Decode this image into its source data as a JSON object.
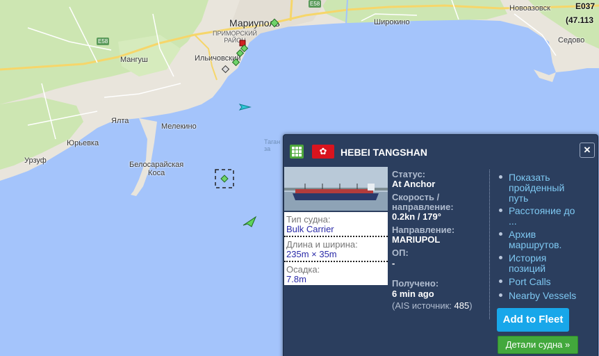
{
  "map": {
    "colors": {
      "sea": "#a4c4fb",
      "land": "#e9e5dc",
      "green": "#cde6b2",
      "highway": "#f6d66a",
      "road": "#ffffff"
    },
    "places": {
      "mariupol": "Мариуполь",
      "primorsky": "ПРИМОРСКИЙ\nРАЙОН",
      "ilyichevsky": "Ильичовский",
      "mangush": "Мангуш",
      "shirokino": "Широкино",
      "novoazovsk": "Новоазовск",
      "sedovo": "Седово",
      "yalta": "Ялта",
      "melekino": "Мелекино",
      "yurievka": "Юрьевка",
      "urzuf": "Урзуф",
      "belosaraiskaya": "Белосарайская\nКоса",
      "taganrog_bay_fragment": "Таган\nза"
    },
    "roads": {
      "e58_left": "E58",
      "e58_top": "E58"
    },
    "corner_coords": {
      "line1": "E037",
      "line2": "(47.113"
    },
    "icons": [
      "vessel-green-diamond-icon",
      "vessel-cyan-arrow-icon",
      "vessel-green-arrow-icon",
      "selection-box-icon"
    ]
  },
  "popup": {
    "vessel_name": "HEBEI TANGSHAN",
    "flag": "hong-kong-flag",
    "close_icon": "close-icon",
    "fleet_icon": "grid-icon",
    "type_label": "Тип судна:",
    "type_value": "Bulk Carrier",
    "dims_label": "Длина и ширина:",
    "dims_value": "235m × 35m",
    "draught_label": "Осадка:",
    "draught_value": "7.8m",
    "status_label": "Статус:",
    "status_value": "At Anchor",
    "speed_label1": "Скорость /",
    "speed_label2": "направление:",
    "speed_value": "0.2kn / 179°",
    "dest_label": "Направление:",
    "dest_value": "MARIUPOL",
    "eta_label": "ОП:",
    "eta_value": "-",
    "received_label": "Получено:",
    "received_value": "6 min ago",
    "ais_prefix": "(AIS источник: ",
    "ais_value": "485",
    "ais_suffix": ")",
    "links": {
      "track": "Показать пройденный путь",
      "distance": "Расстояние до ...",
      "routes": "Архив маршрутов.",
      "history": "История позиций",
      "port_calls": "Port Calls",
      "nearby": "Nearby Vessels"
    },
    "add_fleet": "Add to Fleet",
    "details": "Детали судна »"
  }
}
